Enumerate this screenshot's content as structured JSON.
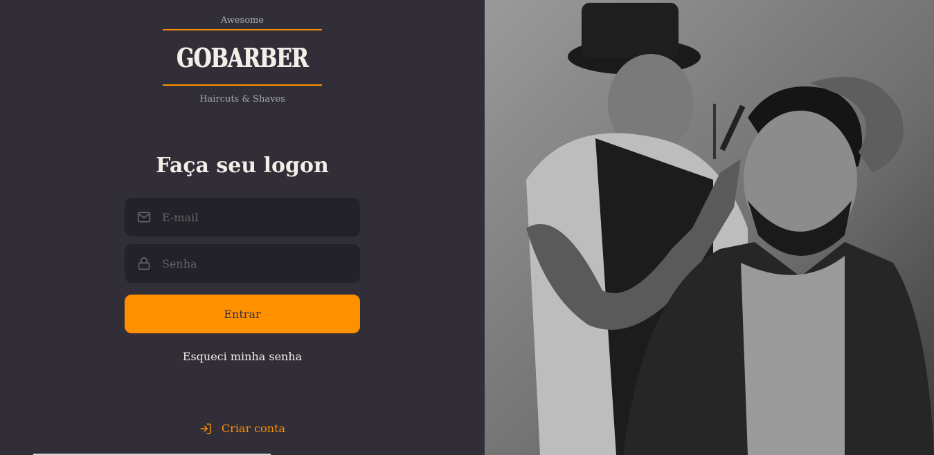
{
  "logo": {
    "top_text": "Awesome",
    "brand": "GOBARBER",
    "bottom_text": "Haircuts & Shaves"
  },
  "form": {
    "title": "Faça seu logon",
    "email_placeholder": "E-mail",
    "password_placeholder": "Senha",
    "submit_label": "Entrar",
    "forgot_label": "Esqueci minha senha"
  },
  "create_account": {
    "label": "Criar conta"
  },
  "icons": {
    "email": "mail-icon",
    "password": "lock-icon",
    "create": "log-in-icon"
  },
  "colors": {
    "background": "#312e38",
    "input_background": "#232129",
    "accent": "#ff9000",
    "text": "#f4ede8",
    "placeholder": "#666360"
  }
}
